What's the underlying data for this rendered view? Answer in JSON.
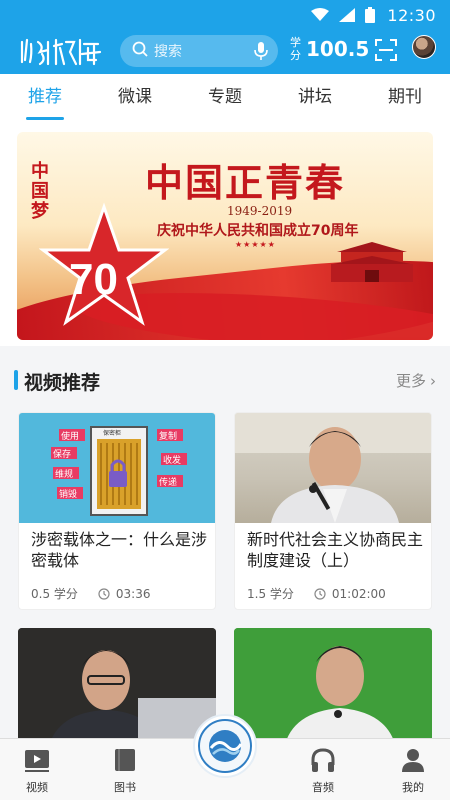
{
  "status_bar": {
    "time": "12:30"
  },
  "header": {
    "logo_text": "浙江学院",
    "search_placeholder": "搜索",
    "credits_label_top": "学",
    "credits_label_bottom": "分",
    "credits_value": "100.5"
  },
  "tabs": [
    {
      "label": "推荐",
      "active": true
    },
    {
      "label": "微课",
      "active": false
    },
    {
      "label": "专题",
      "active": false
    },
    {
      "label": "讲坛",
      "active": false
    },
    {
      "label": "期刊",
      "active": false
    }
  ],
  "banner": {
    "title": "中国正青春",
    "years": "1949-2019",
    "subtitle": "庆祝中华人民共和国成立70周年",
    "stars": "★★★★★",
    "side_text": "中国梦",
    "number": "70"
  },
  "section": {
    "title": "视频推荐",
    "more_label": "更多"
  },
  "videos": [
    {
      "title": "涉密载体之一：什么是涉密载体",
      "credits": "0.5 学分",
      "duration": "03:36",
      "thumb_labels": [
        "使用",
        "保存",
        "维规",
        "销毁",
        "复制",
        "收发",
        "传递",
        "保密柜"
      ]
    },
    {
      "title": "新时代社会主义协商民主制度建设（上）",
      "credits": "1.5 学分",
      "duration": "01:02:00"
    }
  ],
  "bottom_nav": {
    "video": "视频",
    "book": "图书",
    "audio": "音频",
    "mine": "我的"
  },
  "colors": {
    "brand": "#1ea3e8"
  }
}
